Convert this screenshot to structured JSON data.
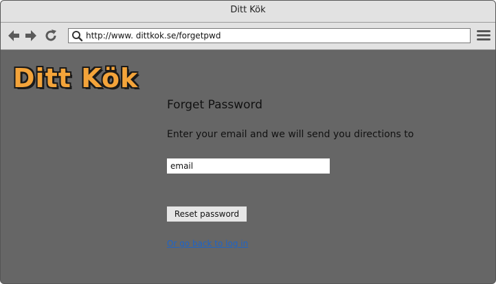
{
  "window": {
    "title": "Ditt Kök"
  },
  "toolbar": {
    "url": "http://www. dittkok.se/forgetpwd"
  },
  "page": {
    "logo_text": "Ditt Kök",
    "title": "Forget Password",
    "instructions": "Enter your email and we will send you directions to",
    "email_value": "email",
    "reset_button_label": "Reset password",
    "back_link_label": "Or go back to log in"
  },
  "colors": {
    "background": "#666666",
    "chrome": "#e2e2e2",
    "logo_fill": "#f4a43a",
    "link": "#1e64c8"
  },
  "icons": [
    "back-arrow-icon",
    "forward-arrow-icon",
    "reload-icon",
    "search-icon",
    "hamburger-menu-icon"
  ]
}
